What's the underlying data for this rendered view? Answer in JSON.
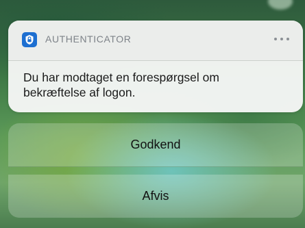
{
  "notification": {
    "app_icon": "lock-shield-icon",
    "app_name": "AUTHENTICATOR",
    "more_icon": "ellipsis-icon",
    "message": "Du har modtaget en forespørgsel om bekræftelse af logon."
  },
  "actions": {
    "approve_label": "Godkend",
    "deny_label": "Afvis"
  },
  "colors": {
    "app_icon_bg": "#1d6fd1",
    "card_bg": "#f6f7f6",
    "app_name_text": "#7d8288"
  }
}
